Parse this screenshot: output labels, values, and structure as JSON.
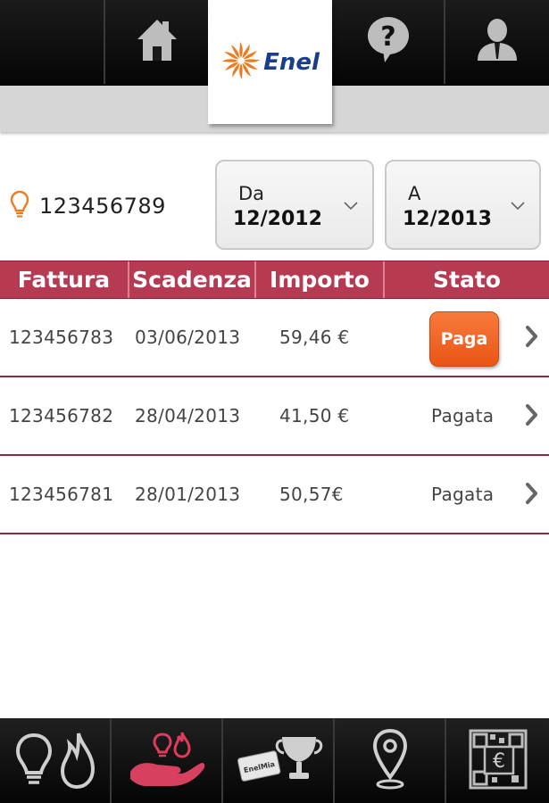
{
  "header": {
    "logo_text": "Enel",
    "home_icon": "home-icon",
    "help_icon": "help-bubble-icon",
    "profile_icon": "user-profile-icon"
  },
  "filter": {
    "supply_icon": "lightbulb-icon",
    "supply_number": "123456789",
    "from_label": "Da",
    "from_value": "12/2012",
    "to_label": "A",
    "to_value": "12/2013"
  },
  "table": {
    "columns": [
      "Fattura",
      "Scadenza",
      "Importo",
      "Stato"
    ],
    "rows": [
      {
        "fattura": "123456783",
        "scadenza": "03/06/2013",
        "importo": "59,46 €",
        "stato": "Paga",
        "payable": true
      },
      {
        "fattura": "123456782",
        "scadenza": "28/04/2013",
        "importo": "41,50 €",
        "stato": "Pagata",
        "payable": false
      },
      {
        "fattura": "123456781",
        "scadenza": "28/01/2013",
        "importo": "50,57€",
        "stato": "Pagata",
        "payable": false
      }
    ]
  },
  "bottom_nav": {
    "items": [
      {
        "icon": "bulb-and-flame-icon"
      },
      {
        "icon": "hand-energy-icon",
        "active": true
      },
      {
        "icon": "enelmia-trophy-icon",
        "card_text": "EnelMia"
      },
      {
        "icon": "location-pin-icon"
      },
      {
        "icon": "qr-euro-icon"
      }
    ]
  },
  "colors": {
    "accent": "#b53a52",
    "row_border": "#8a2b45",
    "pay_button": "#ee5f22",
    "brand_blue": "#1a3e8e",
    "brand_orange": "#ee7a1e"
  }
}
